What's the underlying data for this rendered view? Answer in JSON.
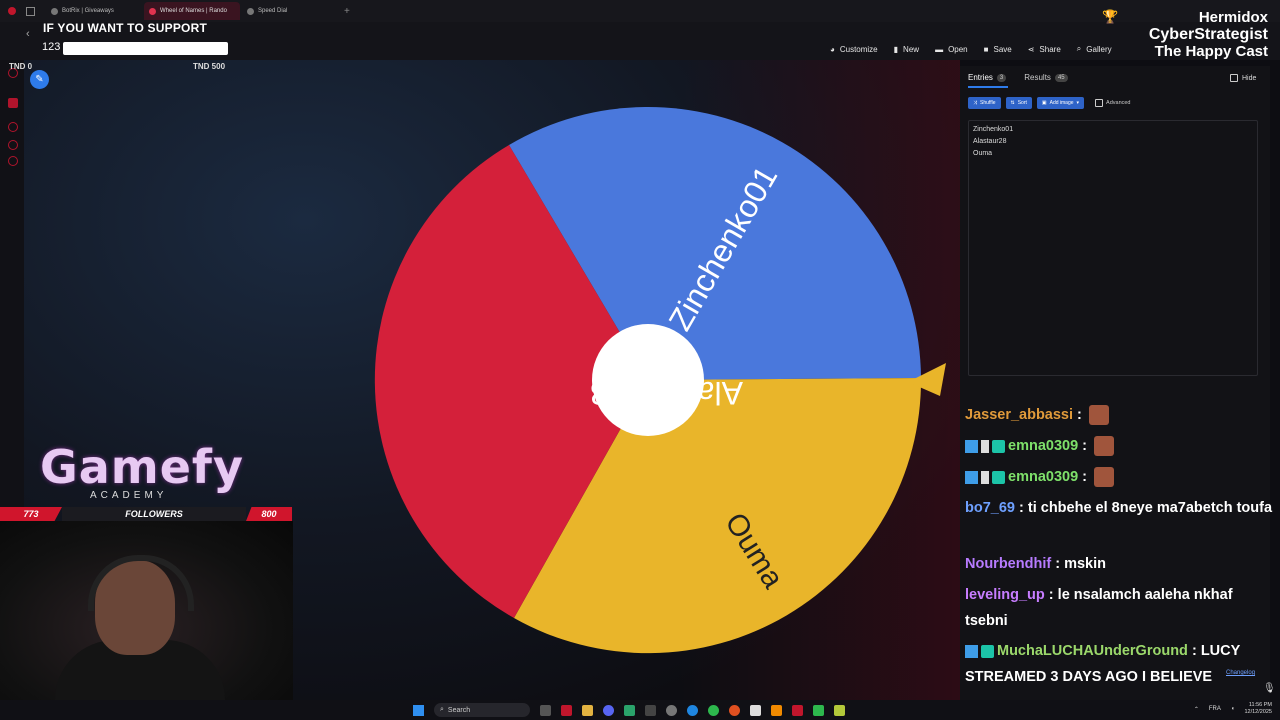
{
  "browser": {
    "tabs": [
      {
        "label": "BotRix | Giveaways",
        "active": false
      },
      {
        "label": "Wheel of Names | Rando",
        "active": true
      },
      {
        "label": "Speed Dial",
        "active": false
      }
    ],
    "new_tab": "+"
  },
  "overlay": {
    "support_text": "IF YOU WANT TO SUPPORT",
    "support_value": "123",
    "goal_min": "TND 0",
    "goal_max": "TND 500",
    "streamer_name": "Hermidox",
    "streamer_line2": "CyberStrategist",
    "streamer_line3": "The Happy Cast"
  },
  "toolbar": {
    "items": [
      {
        "label": "Customize",
        "icon": "palette-icon"
      },
      {
        "label": "New",
        "icon": "file-icon"
      },
      {
        "label": "Open",
        "icon": "folder-icon"
      },
      {
        "label": "Save",
        "icon": "save-icon"
      },
      {
        "label": "Share",
        "icon": "share-icon"
      },
      {
        "label": "Gallery",
        "icon": "search-icon"
      }
    ]
  },
  "wheel": {
    "segments": [
      {
        "label": "Zinchenko01",
        "color": "#4a78dc"
      },
      {
        "label": "Ouma",
        "color": "#e9b52a"
      },
      {
        "label": "Alastaur28",
        "color": "#d4203a"
      }
    ],
    "pointer_color": "#e9b52a"
  },
  "panel": {
    "tab_entries": "Entries",
    "entries_count": "3",
    "tab_results": "Results",
    "results_count": "45",
    "hide_label": "Hide",
    "shuffle_label": "Shuffle",
    "sort_label": "Sort",
    "add_image_label": "Add image",
    "advanced_label": "Advanced",
    "entries": [
      "Zinchenko01",
      "Alastaur28",
      "Ouma"
    ],
    "changelog": "Changelog"
  },
  "chat": [
    {
      "user": "Jasser_abbassi",
      "text": "",
      "emote": true,
      "badges": false
    },
    {
      "user": "emna0309",
      "text": "",
      "emote": true,
      "badges": true
    },
    {
      "user": "emna0309",
      "text": "",
      "emote": true,
      "badges": true
    },
    {
      "user": "bo7_69",
      "text": "ti chbehe el 8neye ma7abetch toufa",
      "emote": false,
      "badges": false
    },
    {
      "user": "Nourbendhif",
      "text": "mskin",
      "emote": false,
      "badges": false
    },
    {
      "user": "leveling_up",
      "text": "le nsalamch aaleha nkhaf tsebni",
      "emote": false,
      "badges": false
    },
    {
      "user": "MuchaLUCHAUnderGround",
      "text": "LUCY STREAMED 3 DAYS AGO I BELIEVE",
      "emote": false,
      "badges": true
    }
  ],
  "branding": {
    "logo": "Gamefy",
    "tagline": "ACADEMY"
  },
  "followers": {
    "current": "773",
    "label": "FOLLOWERS",
    "goal": "800"
  },
  "taskbar": {
    "search_placeholder": "Search",
    "lang": "FRA",
    "time": "11:56 PM",
    "date": "12/12/2025"
  }
}
